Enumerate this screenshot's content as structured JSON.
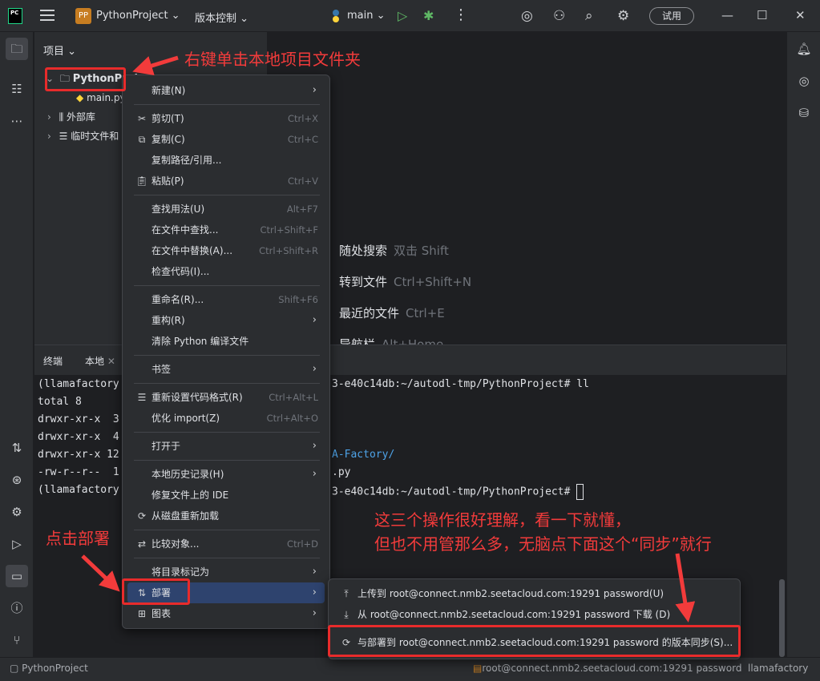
{
  "titlebar": {
    "logo": "PC",
    "project_badge": "PP",
    "project_name": "PythonProject",
    "vcs_label": "版本控制",
    "branch": "main",
    "trial_button": "试用",
    "icons": [
      "hamburger-icon",
      "branch-icon",
      "run-icon",
      "debug-icon",
      "more-icon",
      "ai-assistant-icon",
      "add-user-icon",
      "search-icon",
      "settings-icon",
      "minimize-icon",
      "maximize-icon",
      "close-icon"
    ]
  },
  "project_panel": {
    "title": "项目",
    "tree": [
      {
        "label": "PythonProject",
        "icon": "folder-icon"
      },
      {
        "label": "main.py",
        "icon": "python-file-icon"
      },
      {
        "label": "外部库",
        "icon": "library-icon"
      },
      {
        "label": "临时文件和",
        "icon": "scratch-icon"
      }
    ]
  },
  "editor_hints": [
    {
      "label": "随处搜索",
      "key": "双击 Shift"
    },
    {
      "label": "转到文件",
      "key": "Ctrl+Shift+N"
    },
    {
      "label": "最近的文件",
      "key": "Ctrl+E"
    },
    {
      "label": "导航栏",
      "key": "Alt+Home"
    }
  ],
  "terminal": {
    "tabs": [
      "终端",
      "本地"
    ],
    "lines_left": [
      "(llamafactory",
      "total 8",
      "drwxr-xr-x  3",
      "drwxr-xr-x  4",
      "drwxr-xr-x 12",
      "-rw-r--r--  1",
      "(llamafactory"
    ],
    "lines_right": [
      "3-e40c14db:~/autodl-tmp/PythonProject# ll",
      "",
      "",
      "",
      "A-Factory/",
      ".py",
      "3-e40c14db:~/autodl-tmp/PythonProject# "
    ],
    "accent_line_color": "#4ea3e8"
  },
  "context_menu": {
    "items": [
      {
        "label": "新建(N)",
        "shortcut": "",
        "submenu": true,
        "icon": ""
      },
      {
        "label": "剪切(T)",
        "shortcut": "Ctrl+X",
        "submenu": false,
        "icon": "cut-icon"
      },
      {
        "label": "复制(C)",
        "shortcut": "Ctrl+C",
        "submenu": false,
        "icon": "copy-icon"
      },
      {
        "label": "复制路径/引用...",
        "shortcut": "",
        "submenu": false,
        "icon": ""
      },
      {
        "label": "粘贴(P)",
        "shortcut": "Ctrl+V",
        "submenu": false,
        "icon": "paste-icon"
      },
      {
        "label": "查找用法(U)",
        "shortcut": "Alt+F7",
        "submenu": false,
        "icon": ""
      },
      {
        "label": "在文件中查找...",
        "shortcut": "Ctrl+Shift+F",
        "submenu": false,
        "icon": ""
      },
      {
        "label": "在文件中替换(A)...",
        "shortcut": "Ctrl+Shift+R",
        "submenu": false,
        "icon": ""
      },
      {
        "label": "检查代码(I)...",
        "shortcut": "",
        "submenu": false,
        "icon": ""
      },
      {
        "label": "重命名(R)...",
        "shortcut": "Shift+F6",
        "submenu": false,
        "icon": ""
      },
      {
        "label": "重构(R)",
        "shortcut": "",
        "submenu": true,
        "icon": ""
      },
      {
        "label": "清除 Python 编译文件",
        "shortcut": "",
        "submenu": false,
        "icon": ""
      },
      {
        "label": "书签",
        "shortcut": "",
        "submenu": true,
        "icon": ""
      },
      {
        "label": "重新设置代码格式(R)",
        "shortcut": "Ctrl+Alt+L",
        "submenu": false,
        "icon": "reformat-icon"
      },
      {
        "label": "优化 import(Z)",
        "shortcut": "Ctrl+Alt+O",
        "submenu": false,
        "icon": ""
      },
      {
        "label": "打开于",
        "shortcut": "",
        "submenu": true,
        "icon": ""
      },
      {
        "label": "本地历史记录(H)",
        "shortcut": "",
        "submenu": true,
        "icon": ""
      },
      {
        "label": "修复文件上的 IDE",
        "shortcut": "",
        "submenu": false,
        "icon": ""
      },
      {
        "label": "从磁盘重新加载",
        "shortcut": "",
        "submenu": false,
        "icon": "reload-icon"
      },
      {
        "label": "比较对象...",
        "shortcut": "Ctrl+D",
        "submenu": false,
        "icon": "compare-icon"
      },
      {
        "label": "将目录标记为",
        "shortcut": "",
        "submenu": true,
        "icon": ""
      },
      {
        "label": "部署",
        "shortcut": "",
        "submenu": true,
        "icon": "deploy-icon"
      },
      {
        "label": "图表",
        "shortcut": "",
        "submenu": true,
        "icon": "diagram-icon"
      }
    ]
  },
  "deploy_submenu": {
    "items": [
      {
        "label": "上传到 root@connect.nmb2.seetacloud.com:19291 password(U)",
        "icon": "upload-icon"
      },
      {
        "label": "从 root@connect.nmb2.seetacloud.com:19291 password 下载 (D)",
        "icon": "download-icon"
      },
      {
        "label": "与部署到 root@connect.nmb2.seetacloud.com:19291 password 的版本同步(S)...",
        "icon": "sync-icon"
      }
    ]
  },
  "annotations": {
    "right_click": "右键单击本地项目文件夹",
    "click_deploy": "点击部署",
    "explain_line1": "这三个操作很好理解，看一下就懂，",
    "explain_line2": "但也不用管那么多，无脑点下面这个“同步”就行",
    "color": "#f23b3b"
  },
  "statusbar": {
    "project": "PythonProject",
    "remote": "root@connect.nmb2.seetacloud.com:19291 password",
    "interpreter": "llamafactory"
  }
}
